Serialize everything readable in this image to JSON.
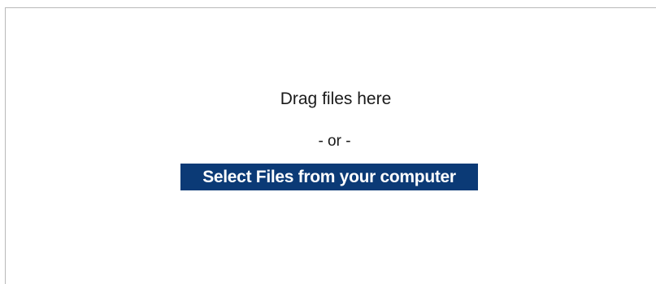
{
  "upload": {
    "drag_text": "Drag files here",
    "or_text": "- or -",
    "select_button_label": "Select Files from your computer",
    "button_color": "#0b3a76"
  }
}
